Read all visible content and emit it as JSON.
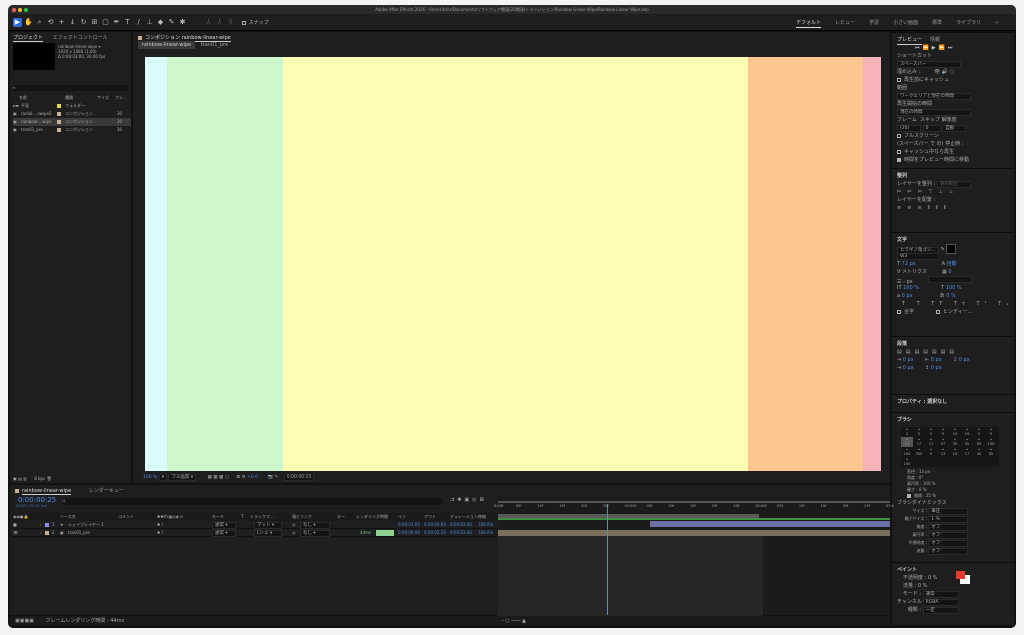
{
  "window": {
    "title": "Adobe After Effects 2026 - /Users/kzhr/Documents/ソフトウェア関連/2D関連/トランジション/Rainbow Linear Wipe/Rainbow Linear Wipe.aep"
  },
  "toolbar": {
    "snap_label": "スナップ",
    "workspaces": [
      "デフォルト",
      "レビュー",
      "学習",
      "小さい画面",
      "標準",
      "ライブラリ"
    ]
  },
  "project": {
    "tabs": [
      "プロジェクト",
      "エフェクトコントロール"
    ],
    "preview_name": "rainbow-linear-wipe ▾",
    "preview_res": "1920 x 1080 (1.00)",
    "preview_dur": "Δ 0:00:03:00, 30.00 fps",
    "search_placeholder": "",
    "columns": [
      "名前",
      "種類",
      "サイズ",
      "フレ..."
    ],
    "items": [
      {
        "name": "平面",
        "type": "フォルダー",
        "fr": "",
        "color": "#e8d84a"
      },
      {
        "name": "radial-...swipe2",
        "type": "コンポジション",
        "fr": "30",
        "color": "#c9b28f"
      },
      {
        "name": "rainbow-...wipe",
        "type": "コンポジション",
        "fr": "30",
        "color": "#c9b28f"
      },
      {
        "name": "tran01_pre",
        "type": "コンポジション",
        "fr": "30",
        "color": "#c9b28f"
      }
    ],
    "bpc": "8 bpc"
  },
  "comp": {
    "panel_title": "コンポジション rainbow-linear-wipe",
    "tabs": [
      "rainbow-linear-wipe",
      "tran01_pre"
    ],
    "stripes": [
      {
        "color": "#d9fbfc",
        "w": 3
      },
      {
        "color": "#ccf7cc",
        "w": 15.8
      },
      {
        "color": "#fdfdb4",
        "w": 63.1
      },
      {
        "color": "#fdc58f",
        "w": 15.6
      },
      {
        "color": "#f8b2b8",
        "w": 2.5
      }
    ],
    "zoom": "100 %",
    "quality": "フル画質",
    "exposure": "+0.0",
    "timecode": "0:00:00:25"
  },
  "timeline": {
    "tabs": [
      "rainbow-linear-wipe",
      "レンダーキュー"
    ],
    "current_time": "0:00:00:25",
    "frame_info": "00025 (30.00 fps)",
    "columns": [
      "ソース名",
      "コメント",
      "モード",
      "T",
      "トラックマ...",
      "親とリンク",
      "キー",
      "レンダリング時間",
      "イン",
      "アウト",
      "デュレーション",
      "伸縮"
    ],
    "layers": [
      {
        "num": "1",
        "name": "シェイプレイヤー 1",
        "color": "#8d8df0",
        "mode": "通常",
        "track": "マット",
        "parent": "なし",
        "render": "",
        "in": "0:00:01:05",
        "out": "0:00:04:04",
        "dur": "0:00:03:00",
        "stretch": "100.0%"
      },
      {
        "num": "2",
        "name": "tran01_pre",
        "color": "#c9b28f",
        "mode": "通常",
        "track": "Lシェ",
        "parent": "なし",
        "render": "44ms",
        "in": "0:00:00:00",
        "out": "0:00:02:29",
        "dur": "0:00:03:00",
        "stretch": "100.0%"
      }
    ],
    "ruler": [
      "0:00f",
      "05f",
      "10f",
      "15f",
      "20f",
      "25f",
      "01:00f",
      "05f",
      "10f",
      "15f",
      "20f",
      "25f",
      "02:00f",
      "05f",
      "10f",
      "15f",
      "20f",
      "25f",
      "03:0"
    ],
    "playhead_frame": 25,
    "total_frames": 90,
    "workarea_end_frame": 60,
    "layer1_start_frame": 35,
    "status": "フレームレンダリング時間 : 44ms"
  },
  "right": {
    "preview": {
      "tabs": [
        "プレビュー",
        "情報"
      ],
      "shortcut_label": "ショートカット",
      "shortcut": "スペースバー",
      "include_label": "埋め込み :",
      "cache_label": "再生前にキャッシュ",
      "range_label": "範囲",
      "range": "ワークエリアと現在の時間",
      "start_label": "再生開始の時間",
      "start": "現在の時間",
      "frame_label": "フレーム",
      "skip_label": "スキップ",
      "res_label": "解像度",
      "frame": "(30)",
      "skip": "0",
      "res": "自動",
      "fullscreen": "フルスクリーン",
      "stop_label": "(スペースバー で の) 停止時 :",
      "opt1": "キャッシュ中なら再生",
      "opt2": "時間をプレビュー時間に移動"
    },
    "align": {
      "title": "整列",
      "align_to_label": "レイヤーを整列 :",
      "align_to": "選択範囲",
      "distribute_label": "レイヤーを配置 :"
    },
    "char": {
      "title": "文字",
      "font": "ヒラギノ角ゴシ...",
      "style": "W3",
      "size": "72 px",
      "leading": "自動",
      "kerning": "メトリクス",
      "tracking": "0",
      "stroke": "- px",
      "vscale": "100 %",
      "hscale": "100 %",
      "baseline": "0 px",
      "tsume": "0 %",
      "ligature": "合字",
      "hindi": "ヒンディー..."
    },
    "para": {
      "title": "段落",
      "values": [
        "0 px",
        "0 px",
        "0 px",
        "0 px",
        "0 px"
      ]
    },
    "props": {
      "title": "プロパティ : 選択なし"
    },
    "brush": {
      "title": "ブラシ",
      "sizes": [
        "1",
        "3",
        "5",
        "9",
        "13",
        "19",
        "5",
        "9",
        "13",
        "17",
        "21",
        "27",
        "35",
        "45",
        "65",
        "100",
        "200",
        "300",
        "9",
        "13",
        "19",
        "17",
        "45",
        "65",
        "100"
      ],
      "diameter": "直径 : 13 px",
      "angle": "角度 : 0°",
      "roundness": "真円率 : 100 %",
      "hardness": "硬さ : 0 %",
      "spacing": "間隔 : 25 %",
      "dyn_label": "ブラシダイナミックス",
      "dyn": [
        [
          "サイズ :",
          "筆圧"
        ],
        [
          "最小サイズ :",
          "1 %"
        ],
        [
          "角度 :",
          "オフ"
        ],
        [
          "真円率 :",
          "オフ"
        ],
        [
          "不透明度 :",
          "オフ"
        ],
        [
          "流量 :",
          "オフ"
        ]
      ]
    },
    "paint": {
      "title": "ペイント",
      "opacity": "不透明度 : 0 %",
      "flow": "流量 : 0 %",
      "mode_label": "モード :",
      "mode": "通常",
      "channel_label": "チャンネル :",
      "channel": "RGBA",
      "duration_label": "種類 :",
      "duration": "一定",
      "fg": "#e8392b",
      "bg": "#ffffff"
    }
  }
}
